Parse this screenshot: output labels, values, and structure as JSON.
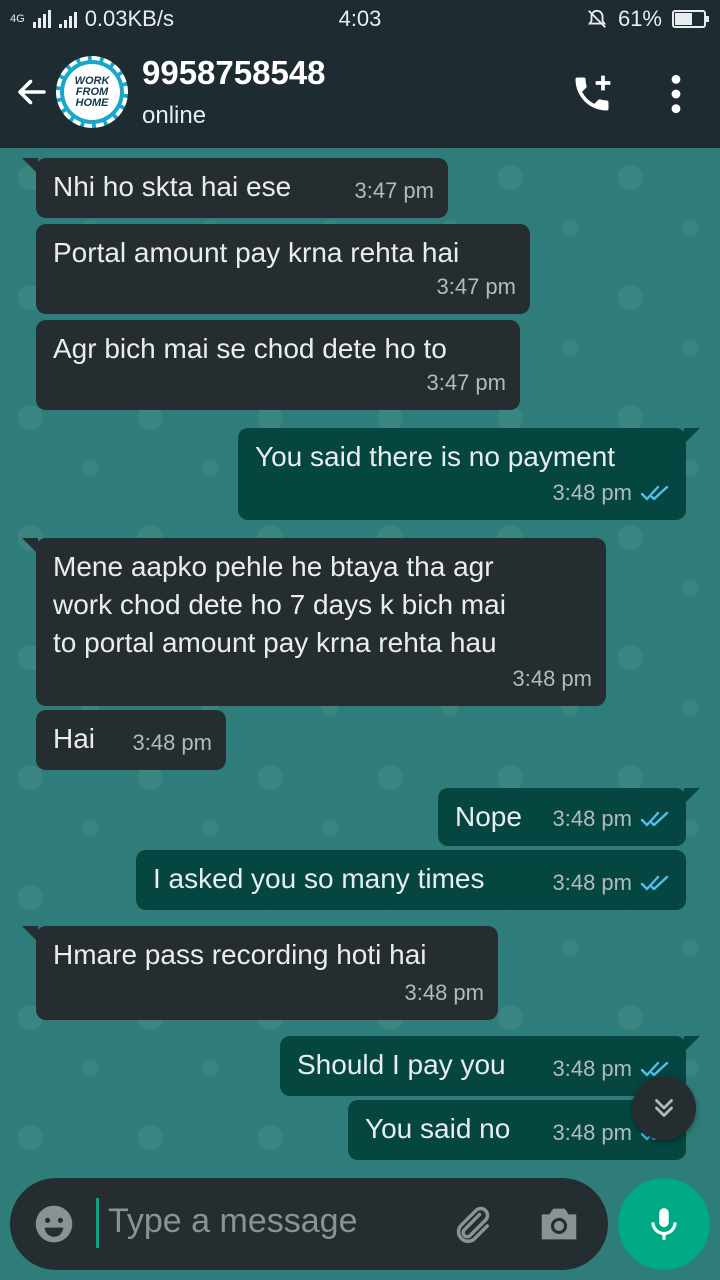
{
  "status_bar": {
    "network": "4G",
    "speed": "0.03KB/s",
    "time": "4:03",
    "battery": "61%",
    "battery_level": 0.61
  },
  "header": {
    "contact_name": "9958758548",
    "status": "online",
    "avatar_text": [
      "WORK",
      "FROM",
      "HOME"
    ]
  },
  "messages": [
    {
      "dir": "in",
      "text": "Nhi ho skta hai ese",
      "time": "3:47 pm"
    },
    {
      "dir": "in",
      "text": "Portal amount pay krna rehta hai",
      "time": "3:47 pm"
    },
    {
      "dir": "in",
      "text": "Agr bich mai se chod dete ho to",
      "time": "3:47 pm"
    },
    {
      "dir": "out",
      "text": "You said there is no payment",
      "time": "3:48 pm",
      "read": true
    },
    {
      "dir": "in",
      "text": [
        "Mene aapko pehle he btaya tha agr",
        "work chod dete ho 7 days k bich mai",
        "to portal amount pay krna rehta hau"
      ],
      "time": "3:48 pm"
    },
    {
      "dir": "in",
      "text": "Hai",
      "time": "3:48 pm"
    },
    {
      "dir": "out",
      "text": "Nope",
      "time": "3:48 pm",
      "read": true
    },
    {
      "dir": "out",
      "text": "I asked you so many times",
      "time": "3:48 pm",
      "read": true
    },
    {
      "dir": "in",
      "text": "Hmare pass recording hoti hai",
      "time": "3:48 pm"
    },
    {
      "dir": "out",
      "text": "Should I pay you",
      "time": "3:48 pm",
      "read": true
    },
    {
      "dir": "out",
      "text": "You said no",
      "time": "3:48 pm",
      "read": true
    }
  ],
  "input": {
    "placeholder": "Type a message"
  },
  "colors": {
    "bar": "#1e2b30",
    "incoming_bubble": "#262d31",
    "outgoing_bubble": "#054740",
    "accent": "#00a884",
    "read_tick": "#53bdeb"
  }
}
